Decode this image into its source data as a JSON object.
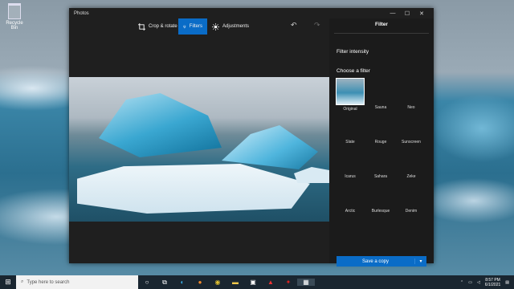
{
  "desktop": {
    "recycle_bin": "Recycle Bin"
  },
  "window": {
    "title": "Photos",
    "controls": {
      "minimize": "—",
      "maximize": "☐",
      "close": "✕"
    }
  },
  "toolbar": {
    "crop_label": "Crop & rotate",
    "filters_label": "Filters",
    "adjustments_label": "Adjustments",
    "undo": "↶",
    "redo": "↷"
  },
  "panel": {
    "title": "Filter",
    "intensity_label": "Filter intensity",
    "choose_label": "Choose a filter",
    "filters": [
      "Original",
      "Sauna",
      "Neo",
      "Slate",
      "Rouge",
      "Sunscreen",
      "Icarus",
      "Sahara",
      "Zeke",
      "Arctic",
      "Burlesque",
      "Denim"
    ],
    "save_label": "Save a copy",
    "save_caret": "▾"
  },
  "taskbar": {
    "search_placeholder": "Type here to search",
    "time": "8:57 PM",
    "date": "6/1/2021"
  },
  "colors": {
    "accent": "#0a6cc7"
  }
}
